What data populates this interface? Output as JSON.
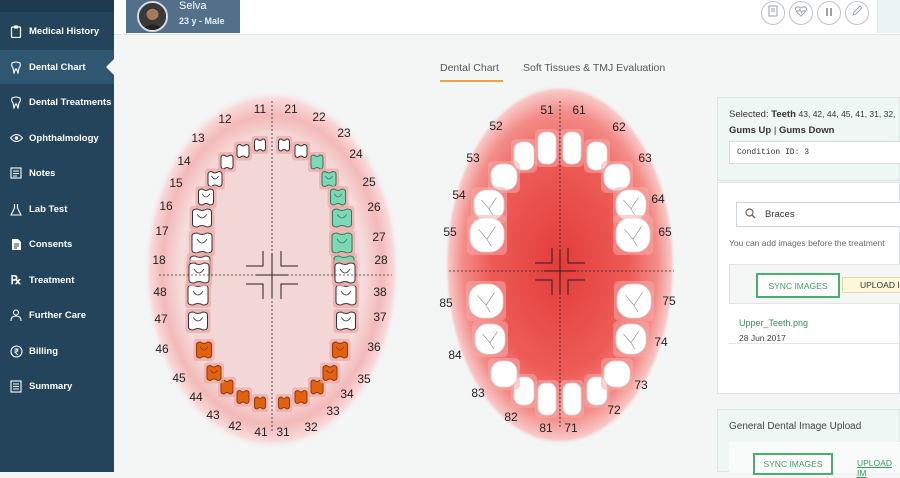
{
  "sidebar": {
    "items": [
      {
        "label": "Medical History",
        "icon": "clipboard-icon"
      },
      {
        "label": "Dental Chart",
        "icon": "tooth-icon"
      },
      {
        "label": "Dental Treatments",
        "icon": "tooth-icon"
      },
      {
        "label": "Ophthalmology",
        "icon": "eye-icon"
      },
      {
        "label": "Notes",
        "icon": "notes-icon"
      },
      {
        "label": "Lab Test",
        "icon": "flask-icon"
      },
      {
        "label": "Consents",
        "icon": "document-icon"
      },
      {
        "label": "Treatment",
        "icon": "rx-icon"
      },
      {
        "label": "Further Care",
        "icon": "user-icon"
      },
      {
        "label": "Billing",
        "icon": "rupee-icon"
      },
      {
        "label": "Summary",
        "icon": "summary-icon"
      }
    ],
    "active": "Dental Chart"
  },
  "patient": {
    "name": "Selva",
    "meta": "23 y - Male"
  },
  "header_actions": [
    "certificate-icon",
    "heartbeat-icon",
    "pause-icon",
    "edit-icon"
  ],
  "tabs": [
    {
      "label": "Dental Chart",
      "active": true
    },
    {
      "label": "Soft Tissues & TMJ Evaluation",
      "active": false
    }
  ],
  "adult_chart": {
    "upper_right": [
      "11",
      "12",
      "13",
      "14",
      "15",
      "16",
      "17",
      "18"
    ],
    "upper_left": [
      "21",
      "22",
      "23",
      "24",
      "25",
      "26",
      "27",
      "28"
    ],
    "lower_left": [
      "31",
      "32",
      "33",
      "34",
      "35",
      "36",
      "37",
      "38"
    ],
    "lower_right": [
      "41",
      "42",
      "43",
      "44",
      "45",
      "46",
      "47",
      "48"
    ],
    "selected_green": [
      "23",
      "24",
      "25",
      "26",
      "27",
      "28"
    ],
    "selected_orange": [
      "31",
      "32",
      "33",
      "34",
      "35",
      "41",
      "42",
      "43",
      "44",
      "45"
    ]
  },
  "child_chart": {
    "upper_right": [
      "51",
      "52",
      "53",
      "54",
      "55"
    ],
    "upper_left": [
      "61",
      "62",
      "63",
      "64",
      "65"
    ],
    "lower_left": [
      "71",
      "72",
      "73",
      "74",
      "75"
    ],
    "lower_right": [
      "81",
      "82",
      "83",
      "84",
      "85"
    ]
  },
  "selection": {
    "prefix": "Selected: ",
    "teeth_label": "Teeth",
    "teeth": "43, 42, 44, 45, 41, 31, 32,",
    "gums_up": "Gums Up",
    "separator": " | ",
    "gums_down": "Gums Down",
    "condition": "Condition ID: 3"
  },
  "images": {
    "search_value": "Braces",
    "hint": "You can add images before the treatment",
    "sync_label": "SYNC IMAGES",
    "upload_label": "UPLOAD IM",
    "file_name": "Upper_Teeth.png",
    "file_date": "28 Jun 2017"
  },
  "general_upload": {
    "title": "General Dental Image Upload",
    "sync_label": "SYNC IMAGES",
    "upload_label": "UPLOAD IM"
  },
  "colors": {
    "sidebar": "#23445b",
    "accent_green": "#4cae6c",
    "selected_green_tooth": "#7fd8b5",
    "selected_orange_tooth": "#e3620f",
    "gum_red": "#e8433f",
    "tab_underline": "#e8a154"
  }
}
